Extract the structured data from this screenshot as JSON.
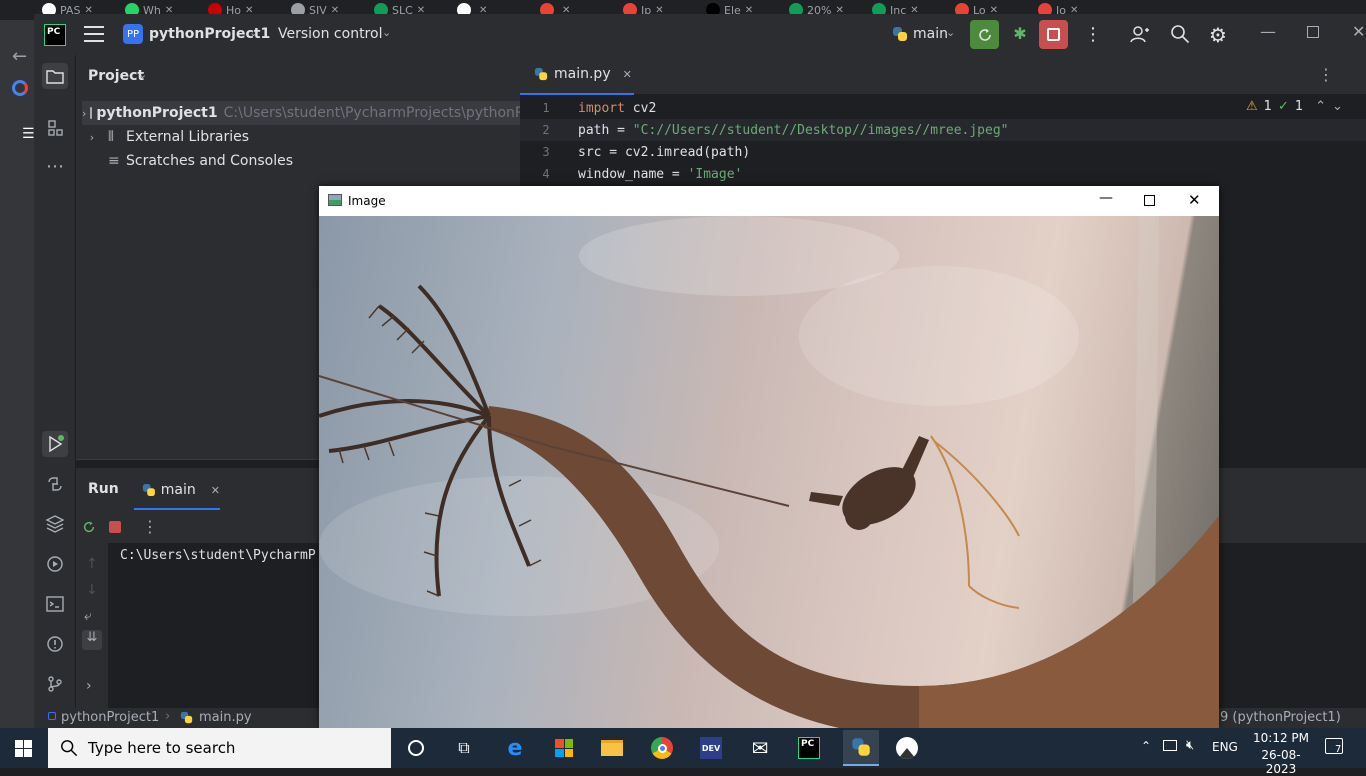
{
  "browser": {
    "tabs": [
      {
        "label": "PAS",
        "color": "#ffffff"
      },
      {
        "label": "Wh",
        "color": "#25d366"
      },
      {
        "label": "Ho",
        "color": "#cc0000"
      },
      {
        "label": "SIV",
        "color": "#9aa0a6"
      },
      {
        "label": "SLC",
        "color": "#0f9d58"
      },
      {
        "label": "",
        "color": "#ffffff"
      },
      {
        "label": "",
        "color": "#ea4335"
      },
      {
        "label": "Ip",
        "color": "#ea4335"
      },
      {
        "label": "Ele",
        "color": "#000000"
      },
      {
        "label": "20%",
        "color": "#0f9d58"
      },
      {
        "label": "Inc",
        "color": "#0f9d58"
      },
      {
        "label": "Lo",
        "color": "#ea4335"
      },
      {
        "label": "Io",
        "color": "#ea4335"
      }
    ],
    "close_glyph": "✕"
  },
  "ide": {
    "logo": "PC",
    "project_badge": "PP",
    "project_name": "pythonProject1",
    "vcs_label": "Version control",
    "run_config": "main",
    "project_panel_title": "Project",
    "tree": [
      {
        "name": "pythonProject1",
        "path": "C:\\Users\\student\\PycharmProjects\\pythonProj"
      },
      {
        "name": "External Libraries"
      },
      {
        "name": "Scratches and Consoles"
      }
    ],
    "editor_tab": "main.py",
    "inspection": {
      "warnings": "1",
      "checks": "1"
    },
    "code_lines": [
      {
        "num": "1",
        "parts": [
          {
            "t": "import",
            "c": "kw"
          },
          {
            "t": " cv2",
            "c": ""
          }
        ]
      },
      {
        "num": "2",
        "parts": [
          {
            "t": "path = ",
            "c": ""
          },
          {
            "t": "\"C://Users//student//Desktop//images//mree.jpeg\"",
            "c": "str"
          }
        ]
      },
      {
        "num": "3",
        "parts": [
          {
            "t": "src = cv2.imread(path)",
            "c": ""
          }
        ]
      },
      {
        "num": "4",
        "parts": [
          {
            "t": "window_name = ",
            "c": ""
          },
          {
            "t": "'Image'",
            "c": "str"
          }
        ]
      }
    ],
    "run_tab_title": "Run",
    "run_config_tab": "main",
    "console_line": "C:\\Users\\student\\PycharmP",
    "status": {
      "breadcrumb_project": "pythonProject1",
      "breadcrumb_file": "main.py",
      "interpreter": "9 (pythonProject1)"
    }
  },
  "image_window": {
    "title": "Image"
  },
  "taskbar": {
    "search_placeholder": "Type here to search",
    "language": "ENG",
    "time": "10:12 PM",
    "date": "26-08-2023",
    "notification_count": "7"
  }
}
